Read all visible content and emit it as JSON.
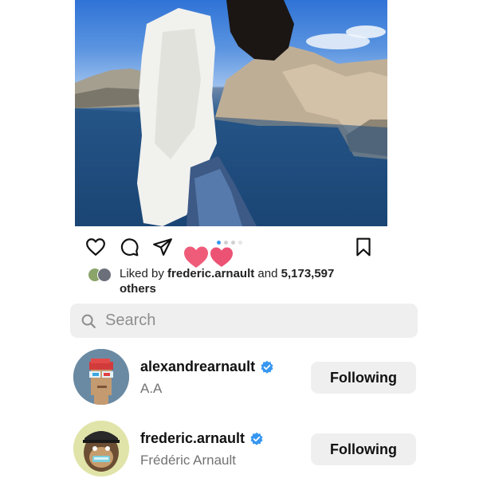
{
  "post": {
    "image_icon": "photo-woman-white-shirt-seaside",
    "actions": {
      "like_icon": "heart-outline-icon",
      "comment_icon": "comment-icon",
      "share_icon": "paper-plane-icon",
      "save_icon": "bookmark-icon"
    },
    "carousel": {
      "count": 4,
      "active_index": 0
    },
    "liked_by": {
      "prefix": "Liked by ",
      "user": "frederic.arnault",
      "middle": " and ",
      "count": "5,173,597",
      "suffix": "others"
    }
  },
  "search": {
    "placeholder": "Search",
    "value": ""
  },
  "users": [
    {
      "username": "alexandrearnault",
      "fullname": "A.A",
      "verified": true,
      "button_label": "Following",
      "avatar_icon": "pixel-punk-avatar"
    },
    {
      "username": "frederic.arnault",
      "fullname": "Frédéric Arnault",
      "verified": true,
      "button_label": "Following",
      "avatar_icon": "bored-ape-avatar"
    }
  ],
  "colors": {
    "verified_blue": "#3797f0",
    "heart_pink": "#ef5c7a",
    "button_bg": "#efefef",
    "secondary_text": "#737373"
  }
}
